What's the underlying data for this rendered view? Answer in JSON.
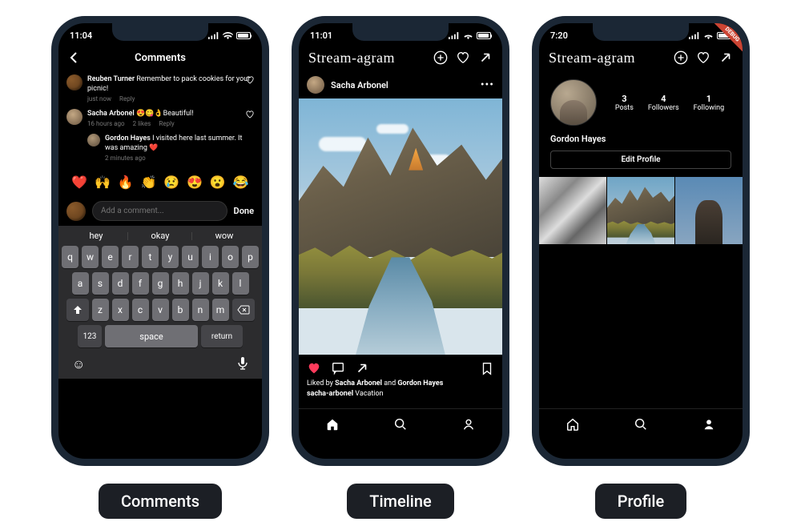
{
  "labels": {
    "comments": "Comments",
    "timeline": "Timeline",
    "profile": "Profile"
  },
  "brand": "Stream-agram",
  "ribbon": "DEBUG",
  "comments_screen": {
    "time": "11:04",
    "title": "Comments",
    "items": [
      {
        "name": "Reuben Turner",
        "text": "Remember to pack cookies for your picnic!",
        "ts": "just now",
        "reply": "Reply"
      },
      {
        "name": "Sacha Arbonel",
        "text": "😍😋👌Beautiful!",
        "ts": "16 hours ago",
        "likes": "2 likes",
        "reply": "Reply",
        "child": {
          "name": "Gordon Hayes",
          "text": "I visited here last summer. It was amazing ❤️",
          "ts": "2 minutes ago"
        }
      }
    ],
    "emojis": [
      "❤️",
      "🙌",
      "🔥",
      "👏",
      "😢",
      "😍",
      "😮",
      "😂"
    ],
    "placeholder": "Add a comment...",
    "done": "Done",
    "sugg": [
      "hey",
      "okay",
      "wow"
    ],
    "row1": [
      "q",
      "w",
      "e",
      "r",
      "t",
      "y",
      "u",
      "i",
      "o",
      "p"
    ],
    "row2": [
      "a",
      "s",
      "d",
      "f",
      "g",
      "h",
      "j",
      "k",
      "l"
    ],
    "row3": [
      "z",
      "x",
      "c",
      "v",
      "b",
      "n",
      "m"
    ],
    "num": "123",
    "space": "space",
    "ret": "return",
    "smile": "😊",
    "mic": "🎤"
  },
  "timeline_screen": {
    "time": "11:01",
    "author": "Sacha Arbonel",
    "liked_prefix": "Liked by ",
    "liker1": "Sacha Arbonel",
    "and": " and ",
    "liker2": "Gordon Hayes",
    "cap_user": "sacha-arbonel",
    "cap_text": " Vacation"
  },
  "profile_screen": {
    "time": "7:20",
    "stats": [
      {
        "n": "3",
        "l": "Posts"
      },
      {
        "n": "4",
        "l": "Followers"
      },
      {
        "n": "1",
        "l": "Following"
      }
    ],
    "name": "Gordon Hayes",
    "edit": "Edit Profile"
  }
}
